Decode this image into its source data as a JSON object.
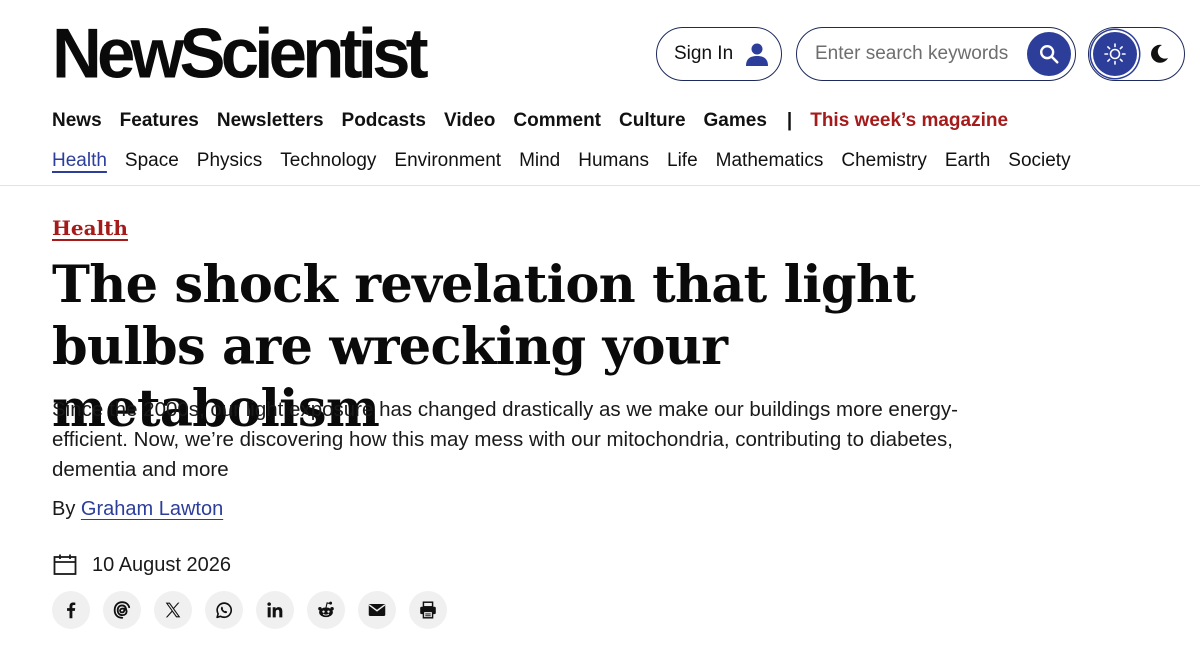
{
  "header": {
    "logo": "NewScientist",
    "signin_label": "Sign In",
    "search_placeholder": "Enter search keywords"
  },
  "nav_primary": {
    "items": [
      "News",
      "Features",
      "Newsletters",
      "Podcasts",
      "Video",
      "Comment",
      "Culture",
      "Games"
    ],
    "separator": "|",
    "magazine": "This week’s magazine"
  },
  "nav_topics": {
    "items": [
      "Health",
      "Space",
      "Physics",
      "Technology",
      "Environment",
      "Mind",
      "Humans",
      "Life",
      "Mathematics",
      "Chemistry",
      "Earth",
      "Society"
    ],
    "active": "Health"
  },
  "article": {
    "section": "Health",
    "headline": "The shock revelation that light bulbs are wrecking your metabolism",
    "standfirst": "Since the 2000s, our light exposure has changed drastically as we make our buildings more energy-efficient. Now, we’re discovering how this may mess with our mitochondria, contributing to diabetes, dementia and more",
    "byline_prefix": "By",
    "author": "Graham Lawton",
    "date": "10 August 2026"
  },
  "share_icons": [
    "facebook-icon",
    "threads-icon",
    "x-icon",
    "whatsapp-icon",
    "linkedin-icon",
    "reddit-icon",
    "email-icon",
    "print-icon"
  ],
  "colors": {
    "brand_blue": "#2c3e99",
    "accent_red": "#a51b1b",
    "text": "#111111",
    "icon_bg": "#f0f0f0"
  }
}
